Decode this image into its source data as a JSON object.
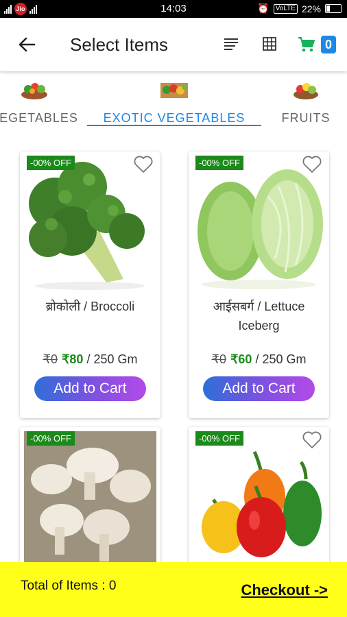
{
  "status_bar": {
    "carrier": "Jio",
    "time": "14:03",
    "volte": "VoLTE",
    "battery": "22%"
  },
  "toolbar": {
    "title": "Select Items",
    "cart_count": "0"
  },
  "tabs": [
    {
      "label": "VEGETABLES",
      "icon": "vegetables-basket-icon"
    },
    {
      "label": "EXOTIC VEGETABLES",
      "icon": "exotic-vegetables-icon",
      "active": true
    },
    {
      "label": "FRUITS",
      "icon": "fruits-basket-icon"
    }
  ],
  "products": [
    {
      "discount": "-00% OFF",
      "name": "ब्रोकोली / Broccoli",
      "mrp": "₹0",
      "price": "₹80",
      "unit": "/ 250 Gm",
      "button": "Add to Cart",
      "image": "broccoli"
    },
    {
      "discount": "-00% OFF",
      "name": "आईसबर्ग / Lettuce Iceberg",
      "mrp": "₹0",
      "price": "₹60",
      "unit": "/ 250 Gm",
      "button": "Add to Cart",
      "image": "lettuce"
    },
    {
      "discount": "-00% OFF",
      "image": "mushroom"
    },
    {
      "discount": "-00% OFF",
      "image": "bell-peppers"
    }
  ],
  "footer": {
    "total_label": "Total of Items : 0",
    "checkout_label": "Checkout ->"
  },
  "colors": {
    "accent": "#1e88e5",
    "discount_badge": "#1b8a1b",
    "footer_bg": "#ffff1a",
    "price_green": "#1b8a1b"
  }
}
